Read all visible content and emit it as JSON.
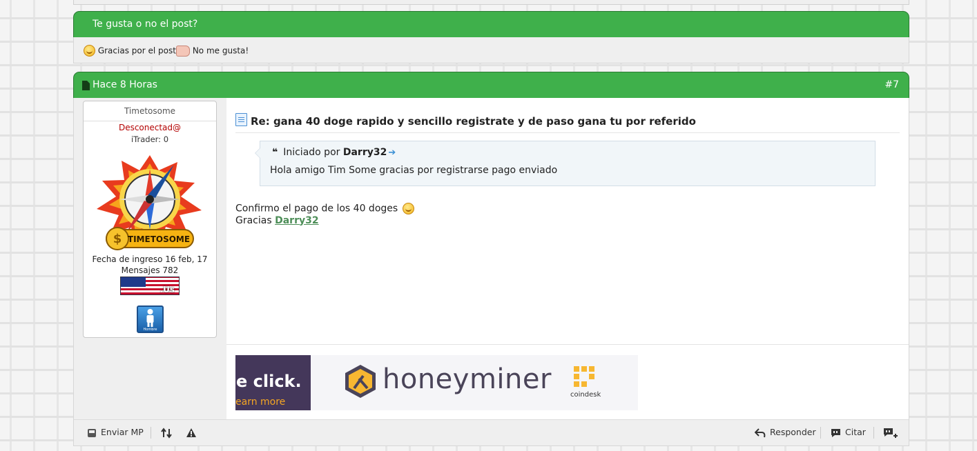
{
  "like_bar": {
    "title": "Te gusta o no el post?",
    "like_label": "Gracias por el post!",
    "dislike_label": "No me gusta!"
  },
  "post": {
    "time": "Hace 8 Horas",
    "number": "#7",
    "title": "Re: gana 40 doge rapido y sencillo registrate y de paso gana tu por referido",
    "quote": {
      "prefix": "Iniciado por",
      "author": "Darry32",
      "text": "Hola amigo Tim Some gracias por registrarse pago enviado"
    },
    "body_line1": "Confirmo el pago de los 40 doges",
    "body_line2_prefix": "Gracias",
    "body_mention": "Darry32"
  },
  "user": {
    "username": "Timetosome",
    "status": "Desconectad@",
    "itrader": "iTrader: 0",
    "avatar_caption": "TIMETOSOME",
    "join_date": "Fecha de ingreso 16 feb, 17",
    "messages": "Mensajes 782",
    "flag_label": ".Us",
    "gender_label": "Hombre"
  },
  "ad": {
    "left_text": "e click.",
    "left_sub": "earn more",
    "brand": "honeyminer",
    "partner": "coindesk"
  },
  "footer": {
    "send_pm": "Enviar MP",
    "reply": "Responder",
    "quote": "Citar"
  },
  "colors": {
    "header_green": "#3fb04b",
    "status_red": "#b30000",
    "mention_green": "#4d8e58"
  }
}
